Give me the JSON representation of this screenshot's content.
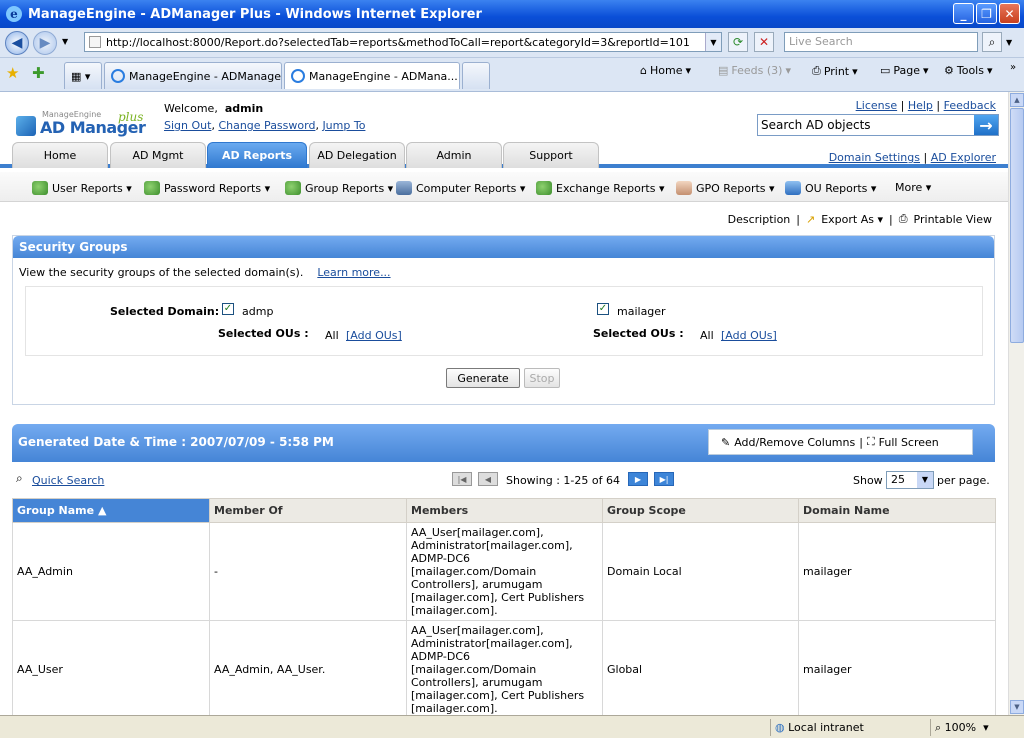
{
  "window": {
    "title": "ManageEngine - ADManager Plus - Windows Internet Explorer"
  },
  "browser": {
    "address": "http://localhost:8000/Report.do?selectedTab=reports&methodToCall=report&categoryId=3&reportId=101",
    "search_placeholder": "Live Search",
    "tabs": [
      "ManageEngine - ADManager ...",
      "ManageEngine - ADMana..."
    ],
    "commands": {
      "home": "Home",
      "feeds": "Feeds (3)",
      "print": "Print",
      "page": "Page",
      "tools": "Tools"
    }
  },
  "header": {
    "logo_small": "ManageEngine",
    "logo_big": "AD Manager",
    "logo_plus": "plus",
    "welcome_prefix": "Welcome,",
    "user": "admin",
    "links": [
      "Sign Out",
      "Change Password",
      "Jump To"
    ],
    "right_links": [
      "License",
      "Help",
      "Feedback"
    ],
    "search_placeholder": "Search AD objects",
    "settings_links": [
      "Domain Settings",
      "AD Explorer"
    ]
  },
  "tabs": [
    "Home",
    "AD Mgmt",
    "AD Reports",
    "AD Delegation",
    "Admin",
    "Support"
  ],
  "submenu": [
    "User Reports",
    "Password Reports",
    "Group Reports",
    "Computer Reports",
    "Exchange Reports",
    "GPO Reports",
    "OU Reports",
    "More"
  ],
  "actions": {
    "description": "Description",
    "export": "Export As",
    "printable": "Printable View"
  },
  "report": {
    "title": "Security Groups",
    "description": "View the security groups of the selected domain(s).",
    "learn_more": "Learn more...",
    "selected_domain_label": "Selected Domain:",
    "selected_ous_label": "Selected OUs :",
    "domains": [
      {
        "name": "admp",
        "ous": "All",
        "add_ous": "[Add OUs]"
      },
      {
        "name": "mailager",
        "ous": "All",
        "add_ous": "[Add OUs]"
      }
    ],
    "generate": "Generate",
    "stop": "Stop"
  },
  "results": {
    "generated": "Generated Date & Time : 2007/07/09 - 5:58 PM",
    "add_remove_columns": "Add/Remove Columns",
    "full_screen": "Full Screen",
    "quick_search": "Quick Search",
    "showing": "Showing : 1-25 of 64",
    "show_label": "Show",
    "per_page_value": "25",
    "per_page_label": "per page.",
    "columns": [
      "Group Name",
      "Member Of",
      "Members",
      "Group Scope",
      "Domain Name"
    ],
    "rows": [
      {
        "group": "AA_Admin",
        "member_of": "-",
        "members": "AA_User[mailager.com], Administrator[mailager.com], ADMP-DC6 [mailager.com/Domain Controllers], arumugam [mailager.com], Cert Publishers [mailager.com].",
        "scope": "Domain Local",
        "domain": "mailager"
      },
      {
        "group": "AA_User",
        "member_of": "AA_Admin, AA_User.",
        "members": "AA_User[mailager.com], Administrator[mailager.com], ADMP-DC6 [mailager.com/Domain Controllers], arumugam [mailager.com], Cert Publishers [mailager.com].",
        "scope": "Global",
        "domain": "mailager"
      }
    ]
  },
  "status": {
    "zone": "Local intranet",
    "zoom": "100%"
  }
}
